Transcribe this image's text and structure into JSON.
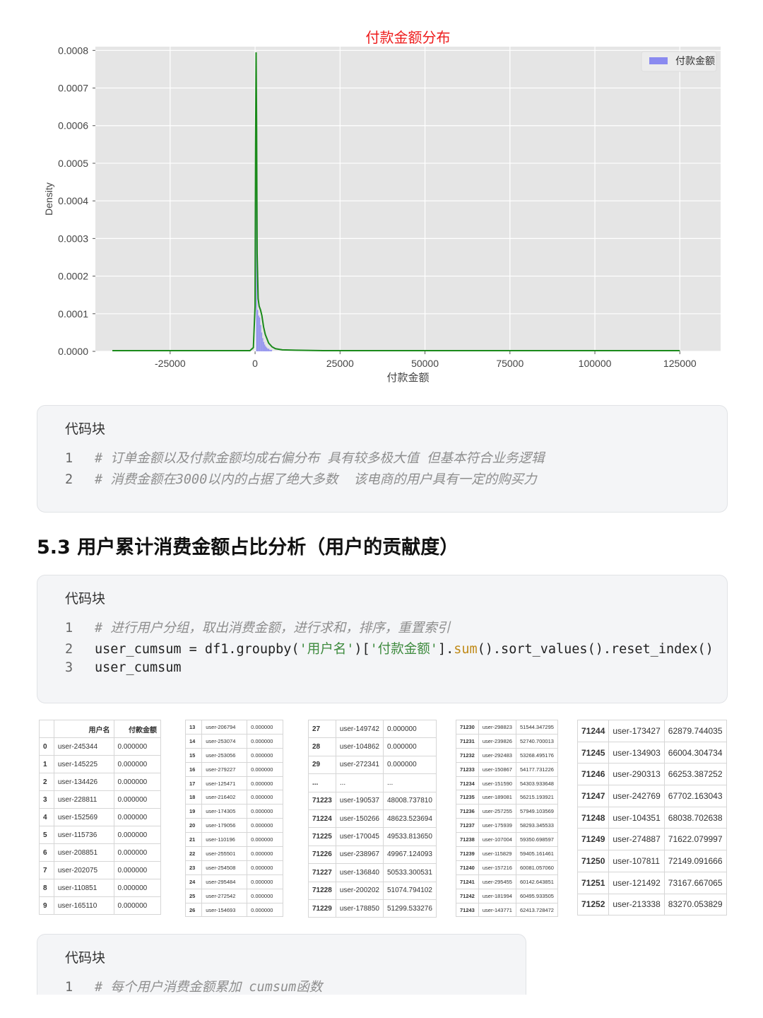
{
  "chart_data": {
    "type": "histogram",
    "title": "付款金额分布",
    "xlabel": "付款金额",
    "ylabel": "Density",
    "xlim": [
      -47000,
      137000
    ],
    "ylim": [
      0,
      0.00081
    ],
    "xticks": [
      -25000,
      0,
      25000,
      50000,
      75000,
      100000,
      125000
    ],
    "xtick_labels": [
      "-25000",
      "0",
      "25000",
      "50000",
      "75000",
      "100000",
      "125000"
    ],
    "yticks": [
      0,
      0.0001,
      0.0002,
      0.0003,
      0.0004,
      0.0005,
      0.0006,
      0.0007,
      0.0008
    ],
    "ytick_labels": [
      "0.0000",
      "0.0001",
      "0.0002",
      "0.0003",
      "0.0004",
      "0.0005",
      "0.0006",
      "0.0007",
      "0.0008"
    ],
    "legend": {
      "label": "付款金额",
      "position": "top-right"
    },
    "grid": true,
    "histogram": {
      "color": "#8a8af0",
      "bin_edges": [
        0,
        300,
        600,
        900,
        1200,
        1500,
        1800,
        2100,
        2400,
        2700,
        3000,
        3300,
        3600,
        4200,
        5000
      ],
      "density": [
        0.0,
        0.00056,
        0.00011,
        9.5e-05,
        9e-05,
        7e-05,
        5e-05,
        3.5e-05,
        2.5e-05,
        1.8e-05,
        1.3e-05,
        1e-05,
        7e-06,
        4e-06
      ]
    },
    "kde": {
      "color": "#1a8a1a",
      "x": [
        -42000,
        -1500,
        -500,
        0,
        150,
        300,
        450,
        600,
        900,
        1200,
        1600,
        2000,
        2500,
        3000,
        4000,
        5000,
        6000,
        8000,
        12000,
        20000,
        40000,
        125000
      ],
      "y": [
        2e-06,
        2e-06,
        1e-05,
        0.00012,
        0.00055,
        0.000795,
        0.0006,
        0.00026,
        0.00014,
        0.00012,
        0.00011,
        9.5e-05,
        6.5e-05,
        4.5e-05,
        2.2e-05,
        1.2e-05,
        7e-06,
        4e-06,
        3e-06,
        2e-06,
        2e-06,
        2e-06
      ]
    }
  },
  "code_block_1": {
    "title": "代码块",
    "lines": [
      {
        "no": "1",
        "text": "# 订单金额以及付款金额均成右偏分布 具有较多极大值 但基本符合业务逻辑"
      },
      {
        "no": "2",
        "text": "# 消费金额在3000以内的占据了绝大多数  该电商的用户具有一定的购买力"
      }
    ]
  },
  "section_heading": "5.3 用户累计消费金额占比分析（用户的贡献度）",
  "code_block_2": {
    "title": "代码块",
    "line1": {
      "no": "1",
      "text": "# 进行用户分组，取出消费金额，进行求和，排序，重置索引"
    },
    "line2": {
      "no": "2",
      "p1": "user_cumsum = df1.groupby(",
      "s1": "'用户名'",
      "p2": ")[",
      "s2": "'付款金额'",
      "p3": "].",
      "f1": "sum",
      "p4": "().sort_values().reset_index()"
    },
    "line3": {
      "no": "3",
      "text": "user_cumsum"
    }
  },
  "table1": {
    "headers": [
      "",
      "用户名",
      "付款金额"
    ],
    "rows": [
      [
        "0",
        "user-245344",
        "0.000000"
      ],
      [
        "1",
        "user-145225",
        "0.000000"
      ],
      [
        "2",
        "user-134426",
        "0.000000"
      ],
      [
        "3",
        "user-228811",
        "0.000000"
      ],
      [
        "4",
        "user-152569",
        "0.000000"
      ],
      [
        "5",
        "user-115736",
        "0.000000"
      ],
      [
        "6",
        "user-208851",
        "0.000000"
      ],
      [
        "7",
        "user-202075",
        "0.000000"
      ],
      [
        "8",
        "user-110851",
        "0.000000"
      ],
      [
        "9",
        "user-165110",
        "0.000000"
      ]
    ]
  },
  "table2": {
    "rows": [
      [
        "13",
        "user-206794",
        "0.000000"
      ],
      [
        "14",
        "user-253074",
        "0.000000"
      ],
      [
        "15",
        "user-253056",
        "0.000000"
      ],
      [
        "16",
        "user-279227",
        "0.000000"
      ],
      [
        "17",
        "user-125471",
        "0.000000"
      ],
      [
        "18",
        "user-216402",
        "0.000000"
      ],
      [
        "19",
        "user-174305",
        "0.000000"
      ],
      [
        "20",
        "user-179056",
        "0.000000"
      ],
      [
        "21",
        "user-110196",
        "0.000000"
      ],
      [
        "22",
        "user-255501",
        "0.000000"
      ],
      [
        "23",
        "user-254508",
        "0.000000"
      ],
      [
        "24",
        "user-295484",
        "0.000000"
      ],
      [
        "25",
        "user-272542",
        "0.000000"
      ],
      [
        "26",
        "user-154693",
        "0.000000"
      ]
    ]
  },
  "table3": {
    "rows": [
      [
        "27",
        "user-149742",
        "0.000000"
      ],
      [
        "28",
        "user-104862",
        "0.000000"
      ],
      [
        "29",
        "user-272341",
        "0.000000"
      ],
      [
        "...",
        "...",
        "..."
      ],
      [
        "71223",
        "user-190537",
        "48008.737810"
      ],
      [
        "71224",
        "user-150266",
        "48623.523694"
      ],
      [
        "71225",
        "user-170045",
        "49533.813650"
      ],
      [
        "71226",
        "user-238967",
        "49967.124093"
      ],
      [
        "71227",
        "user-136840",
        "50533.300531"
      ],
      [
        "71228",
        "user-200202",
        "51074.794102"
      ],
      [
        "71229",
        "user-178850",
        "51299.533276"
      ]
    ]
  },
  "table4": {
    "rows": [
      [
        "71230",
        "user-298823",
        "51544.347295"
      ],
      [
        "71231",
        "user-239826",
        "52740.700013"
      ],
      [
        "71232",
        "user-292483",
        "53268.495176"
      ],
      [
        "71233",
        "user-150867",
        "54177.731226"
      ],
      [
        "71234",
        "user-151590",
        "54303.933648"
      ],
      [
        "71235",
        "user-189081",
        "56215.193921"
      ],
      [
        "71236",
        "user-257255",
        "57949.103569"
      ],
      [
        "71237",
        "user-175939",
        "58293.345533"
      ],
      [
        "71238",
        "user-107004",
        "59350.698597"
      ],
      [
        "71239",
        "user-115829",
        "59405.161461"
      ],
      [
        "71240",
        "user-157216",
        "60081.057060"
      ],
      [
        "71241",
        "user-295455",
        "60142.643851"
      ],
      [
        "71242",
        "user-181994",
        "60495.933505"
      ],
      [
        "71243",
        "user-143771",
        "62413.728472"
      ]
    ]
  },
  "table5": {
    "rows": [
      [
        "71244",
        "user-173427",
        "62879.744035"
      ],
      [
        "71245",
        "user-134903",
        "66004.304734"
      ],
      [
        "71246",
        "user-290313",
        "66253.387252"
      ],
      [
        "71247",
        "user-242769",
        "67702.163043"
      ],
      [
        "71248",
        "user-104351",
        "68038.702638"
      ],
      [
        "71249",
        "user-274887",
        "71622.079997"
      ],
      [
        "71250",
        "user-107811",
        "72149.091666"
      ],
      [
        "71251",
        "user-121492",
        "73167.667065"
      ],
      [
        "71252",
        "user-213338",
        "83270.053829"
      ]
    ]
  },
  "code_block_3": {
    "title": "代码块",
    "lines": [
      {
        "no": "1",
        "text": "# 每个用户消费金额累加 cumsum函数"
      }
    ]
  }
}
